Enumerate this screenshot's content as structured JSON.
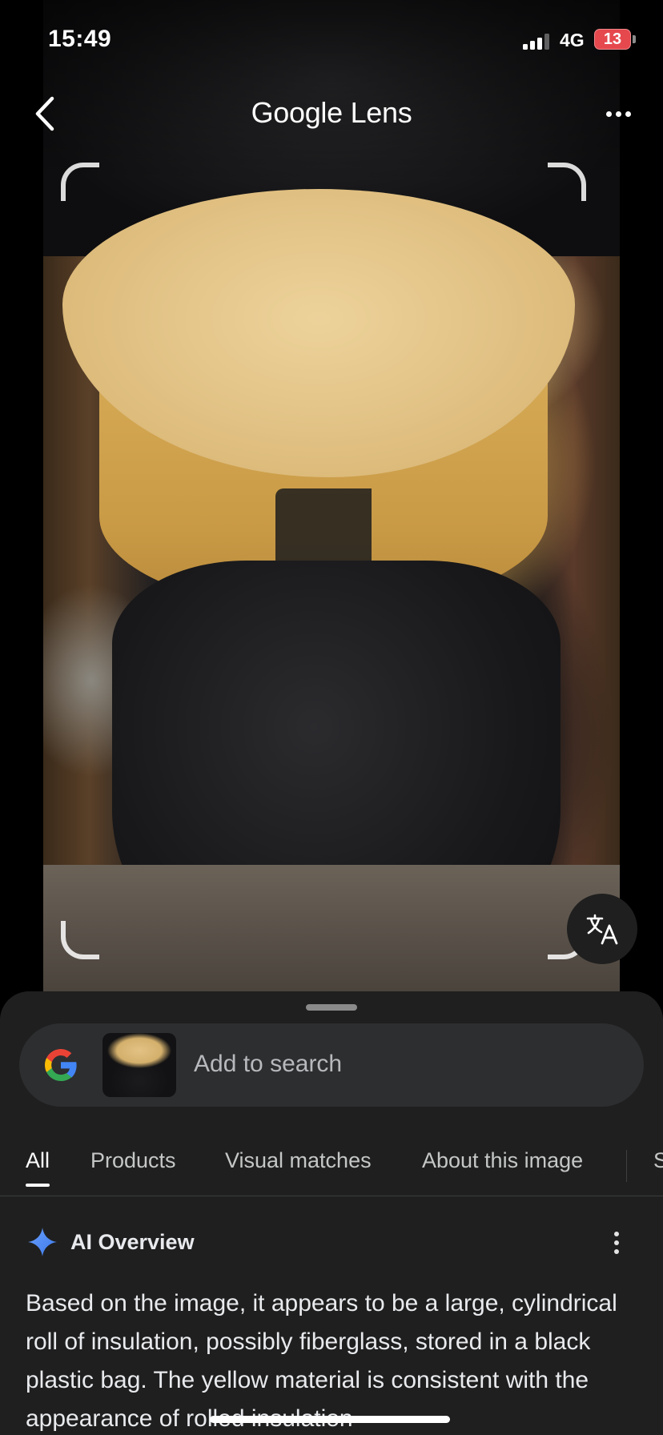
{
  "status_bar": {
    "time": "15:49",
    "network": "4G",
    "battery": "13",
    "battery_color": "#e5484d"
  },
  "top_bar": {
    "brand_google": "Google",
    "brand_lens": "Lens",
    "back_icon": "chevron-left-icon",
    "more_icon": "more-horizontal-icon"
  },
  "photo": {
    "translate_icon": "translate-icon"
  },
  "search": {
    "placeholder": "Add to search"
  },
  "tabs": [
    {
      "label": "All",
      "active": true
    },
    {
      "label": "Products",
      "active": false
    },
    {
      "label": "Visual matches",
      "active": false
    },
    {
      "label": "About this image",
      "active": false
    },
    {
      "label": "S",
      "active": false
    }
  ],
  "ai_overview": {
    "title": "AI Overview",
    "text": "Based on the image, it appears to be a large, cylindrical roll of insulation, possibly fiberglass, stored in a black plastic bag. The yellow material is consistent with the appearance of rolled insulation",
    "accent": "#4f8ff7"
  }
}
